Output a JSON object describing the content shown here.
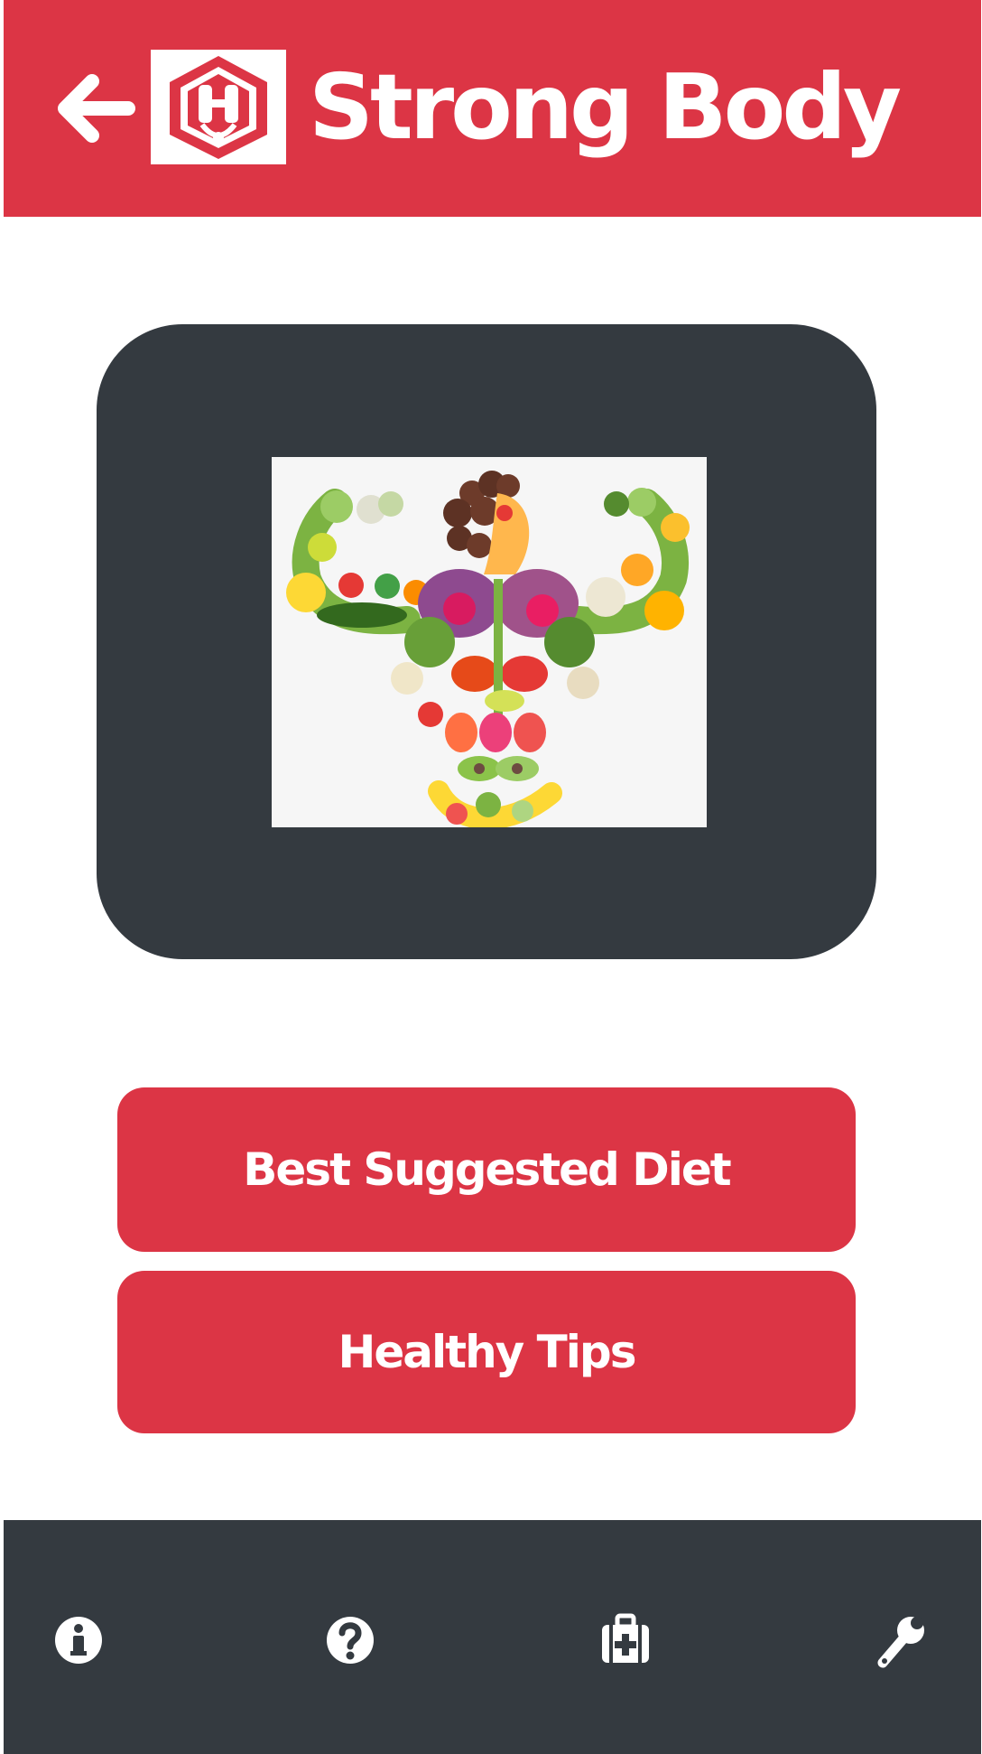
{
  "header": {
    "title": "Strong Body",
    "back_icon": "arrow-left-icon",
    "logo_icon": "dumbbell-hexagon-logo"
  },
  "main": {
    "image_semantic": "vegetables-muscle-body-photo"
  },
  "buttons": {
    "diet_label": "Best Suggested Diet",
    "tips_label": "Healthy Tips"
  },
  "bottom_nav": {
    "items": [
      {
        "icon": "info-icon"
      },
      {
        "icon": "help-icon"
      },
      {
        "icon": "first-aid-kit-icon"
      },
      {
        "icon": "wrench-icon"
      }
    ]
  },
  "colors": {
    "primary": "#dc3545",
    "dark": "#343a40",
    "background": "#ffffff"
  }
}
